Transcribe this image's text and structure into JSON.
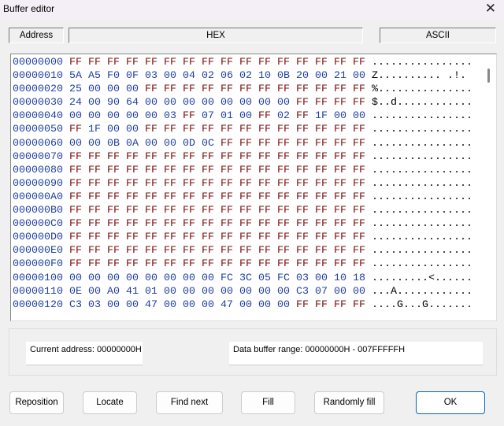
{
  "window": {
    "title": "Buffer editor"
  },
  "columns": {
    "address": "Address",
    "hex": "HEX",
    "ascii": "ASCII"
  },
  "colors": {
    "address": "#1f3fa0",
    "ff_byte": "#7a1010",
    "other_byte": "#1f3fa0"
  },
  "rows": [
    {
      "addr": "00000000",
      "hex": "FF FF FF FF FF FF FF FF FF FF FF FF FF FF FF FF",
      "ascii": "................"
    },
    {
      "addr": "00000010",
      "hex": "5A A5 F0 0F 03 00 04 02 06 02 10 0B 20 00 21 00",
      "ascii": "Z.......... .!."
    },
    {
      "addr": "00000020",
      "hex": "25 00 00 00 FF FF FF FF FF FF FF FF FF FF FF FF",
      "ascii": "%..............."
    },
    {
      "addr": "00000030",
      "hex": "24 00 90 64 00 00 00 00 00 00 00 00 FF FF FF FF",
      "ascii": "$..d............"
    },
    {
      "addr": "00000040",
      "hex": "00 00 00 00 00 03 FF 07 01 00 FF 02 FF 1F 00 00",
      "ascii": "................"
    },
    {
      "addr": "00000050",
      "hex": "FF 1F 00 00 FF FF FF FF FF FF FF FF FF FF FF FF",
      "ascii": "................"
    },
    {
      "addr": "00000060",
      "hex": "00 00 0B 0A 00 00 0D 0C FF FF FF FF FF FF FF FF",
      "ascii": "................"
    },
    {
      "addr": "00000070",
      "hex": "FF FF FF FF FF FF FF FF FF FF FF FF FF FF FF FF",
      "ascii": "................"
    },
    {
      "addr": "00000080",
      "hex": "FF FF FF FF FF FF FF FF FF FF FF FF FF FF FF FF",
      "ascii": "................"
    },
    {
      "addr": "00000090",
      "hex": "FF FF FF FF FF FF FF FF FF FF FF FF FF FF FF FF",
      "ascii": "................"
    },
    {
      "addr": "000000A0",
      "hex": "FF FF FF FF FF FF FF FF FF FF FF FF FF FF FF FF",
      "ascii": "................"
    },
    {
      "addr": "000000B0",
      "hex": "FF FF FF FF FF FF FF FF FF FF FF FF FF FF FF FF",
      "ascii": "................"
    },
    {
      "addr": "000000C0",
      "hex": "FF FF FF FF FF FF FF FF FF FF FF FF FF FF FF FF",
      "ascii": "................"
    },
    {
      "addr": "000000D0",
      "hex": "FF FF FF FF FF FF FF FF FF FF FF FF FF FF FF FF",
      "ascii": "................"
    },
    {
      "addr": "000000E0",
      "hex": "FF FF FF FF FF FF FF FF FF FF FF FF FF FF FF FF",
      "ascii": "................"
    },
    {
      "addr": "000000F0",
      "hex": "FF FF FF FF FF FF FF FF FF FF FF FF FF FF FF FF",
      "ascii": "................"
    },
    {
      "addr": "00000100",
      "hex": "00 00 00 00 00 00 00 00 FC 3C 05 FC 03 00 10 18",
      "ascii": ".........<......"
    },
    {
      "addr": "00000110",
      "hex": "0E 00 A0 41 01 00 00 00 00 00 00 00 C3 07 00 00",
      "ascii": "...A............"
    },
    {
      "addr": "00000120",
      "hex": "C3 03 00 00 47 00 00 00 47 00 00 00 FF FF FF FF",
      "ascii": "....G...G......."
    }
  ],
  "status": {
    "current_address": "Current address: 00000000H",
    "buffer_range": "Data buffer range: 00000000H - 007FFFFFH"
  },
  "buttons": {
    "reposition": "Reposition",
    "locate": "Locate",
    "find_next": "Find next",
    "fill": "Fill",
    "randomly_fill": "Randomly fill",
    "ok": "OK"
  }
}
